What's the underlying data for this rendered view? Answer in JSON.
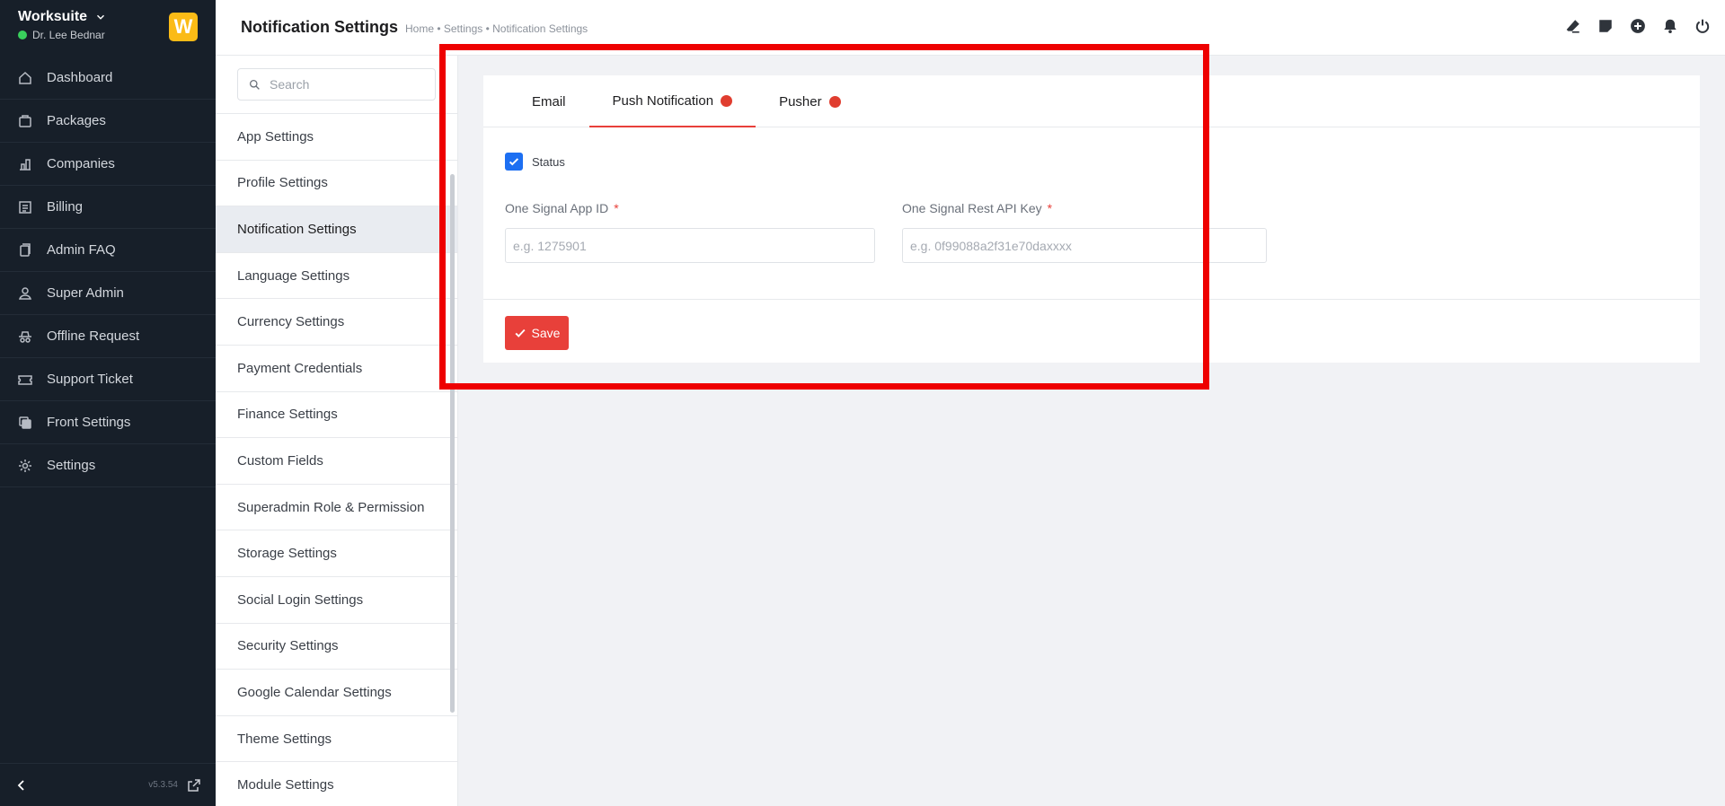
{
  "brand": {
    "name": "Worksuite",
    "user": "Dr. Lee Bednar",
    "logo_letter": "W",
    "logo_color": "#fbbb16",
    "online_color": "#39d05c"
  },
  "nav": [
    {
      "label": "Dashboard",
      "icon": "house-icon"
    },
    {
      "label": "Packages",
      "icon": "package-icon"
    },
    {
      "label": "Companies",
      "icon": "building-icon"
    },
    {
      "label": "Billing",
      "icon": "receipt-icon"
    },
    {
      "label": "Admin FAQ",
      "icon": "document-icon"
    },
    {
      "label": "Super Admin",
      "icon": "user-icon"
    },
    {
      "label": "Offline Request",
      "icon": "incognito-icon"
    },
    {
      "label": "Support Ticket",
      "icon": "ticket-icon"
    },
    {
      "label": "Front Settings",
      "icon": "layers-icon"
    },
    {
      "label": "Settings",
      "icon": "gear-icon"
    }
  ],
  "footer": {
    "version": "v5.3.54"
  },
  "header": {
    "title": "Notification Settings",
    "breadcrumb": "Home • Settings • Notification Settings"
  },
  "settings_menu": {
    "search_placeholder": "Search",
    "items": [
      "App Settings",
      "Profile Settings",
      "Notification Settings",
      "Language Settings",
      "Currency Settings",
      "Payment Credentials",
      "Finance Settings",
      "Custom Fields",
      "Superadmin Role & Permission",
      "Storage Settings",
      "Social Login Settings",
      "Security Settings",
      "Google Calendar Settings",
      "Theme Settings",
      "Module Settings"
    ],
    "active_index": 2
  },
  "tabs": [
    {
      "label": "Email",
      "dot": false
    },
    {
      "label": "Push Notification",
      "dot": true
    },
    {
      "label": "Pusher",
      "dot": true
    }
  ],
  "form": {
    "status_label": "Status",
    "status_checked": true,
    "app_id_label": "One Signal App ID",
    "app_id_placeholder": "e.g. 1275901",
    "api_key_label": "One Signal Rest API Key",
    "api_key_placeholder": "e.g. 0f99088a2f31e70daxxxx",
    "required_mark": "*",
    "save_label": "Save"
  },
  "colors": {
    "accent": "#e8403a",
    "sidebar_bg": "#171f29",
    "checkbox": "#1d6ff2",
    "highlight": "#ee0000"
  }
}
